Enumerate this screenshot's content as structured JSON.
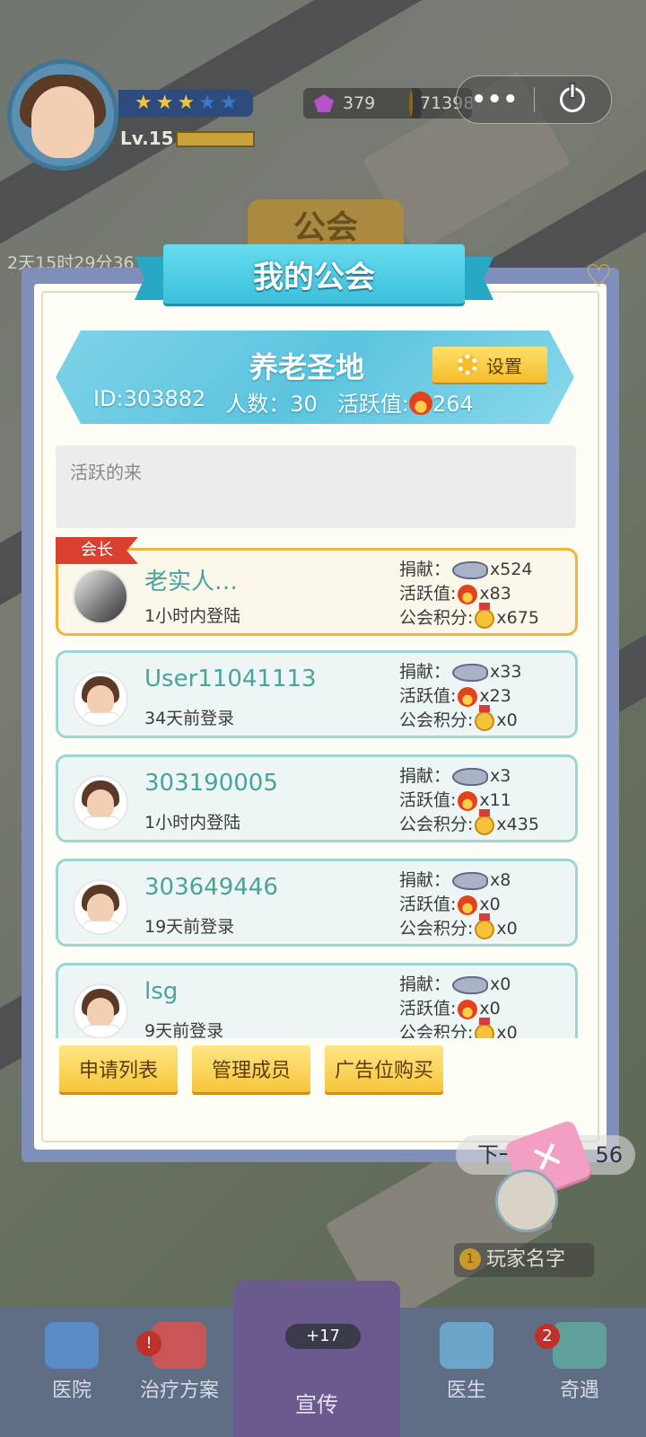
{
  "hud": {
    "level": "Lv.15",
    "stars_filled": 3,
    "stars_total": 5,
    "gems": "379",
    "coins": "71398",
    "menu_dots": "•••",
    "timer": "2天15时29分36",
    "guild_tab": "公会"
  },
  "modal": {
    "title": "我的公会",
    "guild": {
      "name": "养老圣地",
      "id": "ID:303882",
      "members": "人数：30",
      "activity_label": "活跃值:",
      "activity_value": "264",
      "settings_label": "设置"
    },
    "notice": "活跃的来",
    "leader_tag": "会长",
    "stat_labels": {
      "donate": "捐献：",
      "activity": "活跃值:",
      "points": "公会积分:"
    },
    "members": [
      {
        "name": "老实人…",
        "login": "1小时内登陆",
        "donate": "x524",
        "activity": "x83",
        "points": "x675"
      },
      {
        "name": "User11041113",
        "login": "34天前登录",
        "donate": "x33",
        "activity": "x23",
        "points": "x0"
      },
      {
        "name": "303190005",
        "login": "1小时内登陆",
        "donate": "x3",
        "activity": "x11",
        "points": "x435"
      },
      {
        "name": "303649446",
        "login": "19天前登录",
        "donate": "x8",
        "activity": "x0",
        "points": "x0"
      },
      {
        "name": "lsg",
        "login": "9天前登录",
        "donate": "x0",
        "activity": "x0",
        "points": "x0"
      }
    ],
    "buttons": {
      "apply_list": "申请列表",
      "manage_members": "管理成员",
      "ad_purchase": "广告位购买"
    },
    "close_icon": "✕"
  },
  "background": {
    "next_bubble": "下一",
    "next_number": "56",
    "player_name": "玩家名字"
  },
  "nav": {
    "hospital": "医院",
    "treatment": "治疗方案",
    "promote": "宣传",
    "promote_badge": "+17",
    "doctor": "医生",
    "encounter": "奇遇",
    "encounter_badge": "2"
  }
}
